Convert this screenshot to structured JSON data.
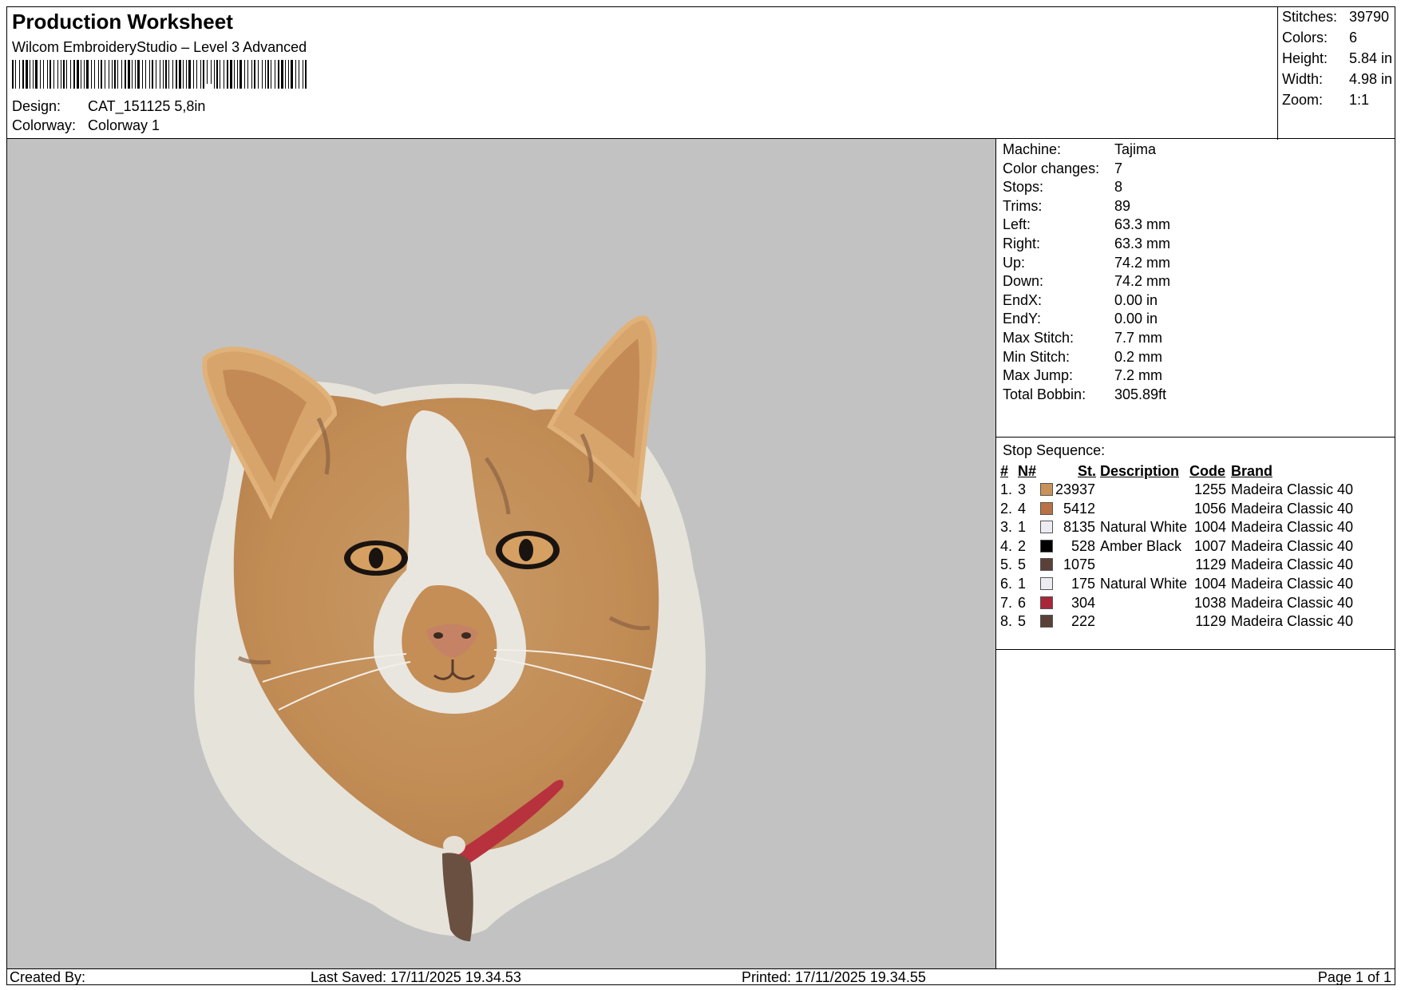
{
  "header": {
    "title": "Production Worksheet",
    "subtitle": "Wilcom EmbroideryStudio – Level 3 Advanced",
    "design_label": "Design:",
    "design_value": "CAT_151125 5,8in",
    "colorway_label": "Colorway:",
    "colorway_value": "Colorway 1"
  },
  "stats": {
    "stitches_label": "Stitches:",
    "stitches_value": "39790",
    "colors_label": "Colors:",
    "colors_value": "6",
    "height_label": "Height:",
    "height_value": "5.84 in",
    "width_label": "Width:",
    "width_value": "4.98 in",
    "zoom_label": "Zoom:",
    "zoom_value": "1:1"
  },
  "machine_info": [
    {
      "label": "Machine:",
      "value": "Tajima"
    },
    {
      "label": "Color changes:",
      "value": "7"
    },
    {
      "label": "Stops:",
      "value": "8"
    },
    {
      "label": "Trims:",
      "value": "89"
    },
    {
      "label": "Left:",
      "value": "63.3 mm"
    },
    {
      "label": "Right:",
      "value": "63.3 mm"
    },
    {
      "label": "Up:",
      "value": "74.2 mm"
    },
    {
      "label": "Down:",
      "value": "74.2 mm"
    },
    {
      "label": "EndX:",
      "value": "0.00 in"
    },
    {
      "label": "EndY:",
      "value": "0.00 in"
    },
    {
      "label": "Max Stitch:",
      "value": "7.7 mm"
    },
    {
      "label": "Min Stitch:",
      "value": "0.2 mm"
    },
    {
      "label": "Max Jump:",
      "value": "7.2 mm"
    },
    {
      "label": "Total Bobbin:",
      "value": "305.89ft"
    }
  ],
  "stop_sequence": {
    "title": "Stop Sequence:",
    "headers": {
      "num": "#",
      "n": "N#",
      "st": "St.",
      "description": "Description",
      "code": "Code",
      "brand": "Brand"
    },
    "rows": [
      {
        "num": "1.",
        "n": "3",
        "st": "23937",
        "description": "",
        "code": "1255",
        "brand": "Madeira Classic 40",
        "color": "#c8935a"
      },
      {
        "num": "2.",
        "n": "4",
        "st": "5412",
        "description": "",
        "code": "1056",
        "brand": "Madeira Classic 40",
        "color": "#b87244"
      },
      {
        "num": "3.",
        "n": "1",
        "st": "8135",
        "description": "Natural White",
        "code": "1004",
        "brand": "Madeira Classic 40",
        "color": "#ececf2"
      },
      {
        "num": "4.",
        "n": "2",
        "st": "528",
        "description": "Amber Black",
        "code": "1007",
        "brand": "Madeira Classic 40",
        "color": "#000000"
      },
      {
        "num": "5.",
        "n": "5",
        "st": "1075",
        "description": "",
        "code": "1129",
        "brand": "Madeira Classic 40",
        "color": "#5a4038"
      },
      {
        "num": "6.",
        "n": "1",
        "st": "175",
        "description": "Natural White",
        "code": "1004",
        "brand": "Madeira Classic 40",
        "color": "#ececf2"
      },
      {
        "num": "7.",
        "n": "6",
        "st": "304",
        "description": "",
        "code": "1038",
        "brand": "Madeira Classic 40",
        "color": "#a8283a"
      },
      {
        "num": "8.",
        "n": "5",
        "st": "222",
        "description": "",
        "code": "1129",
        "brand": "Madeira Classic 40",
        "color": "#5a4038"
      }
    ]
  },
  "footer": {
    "created_by": "Created By:",
    "last_saved": "Last Saved: 17/11/2025 19.34.53",
    "printed": "Printed: 17/11/2025 19.34.55",
    "page": "Page 1 of 1"
  },
  "colors": {
    "preview_background": "#c2c2c2",
    "fur_orange": "#c8935a",
    "fur_white": "#ececf2"
  }
}
